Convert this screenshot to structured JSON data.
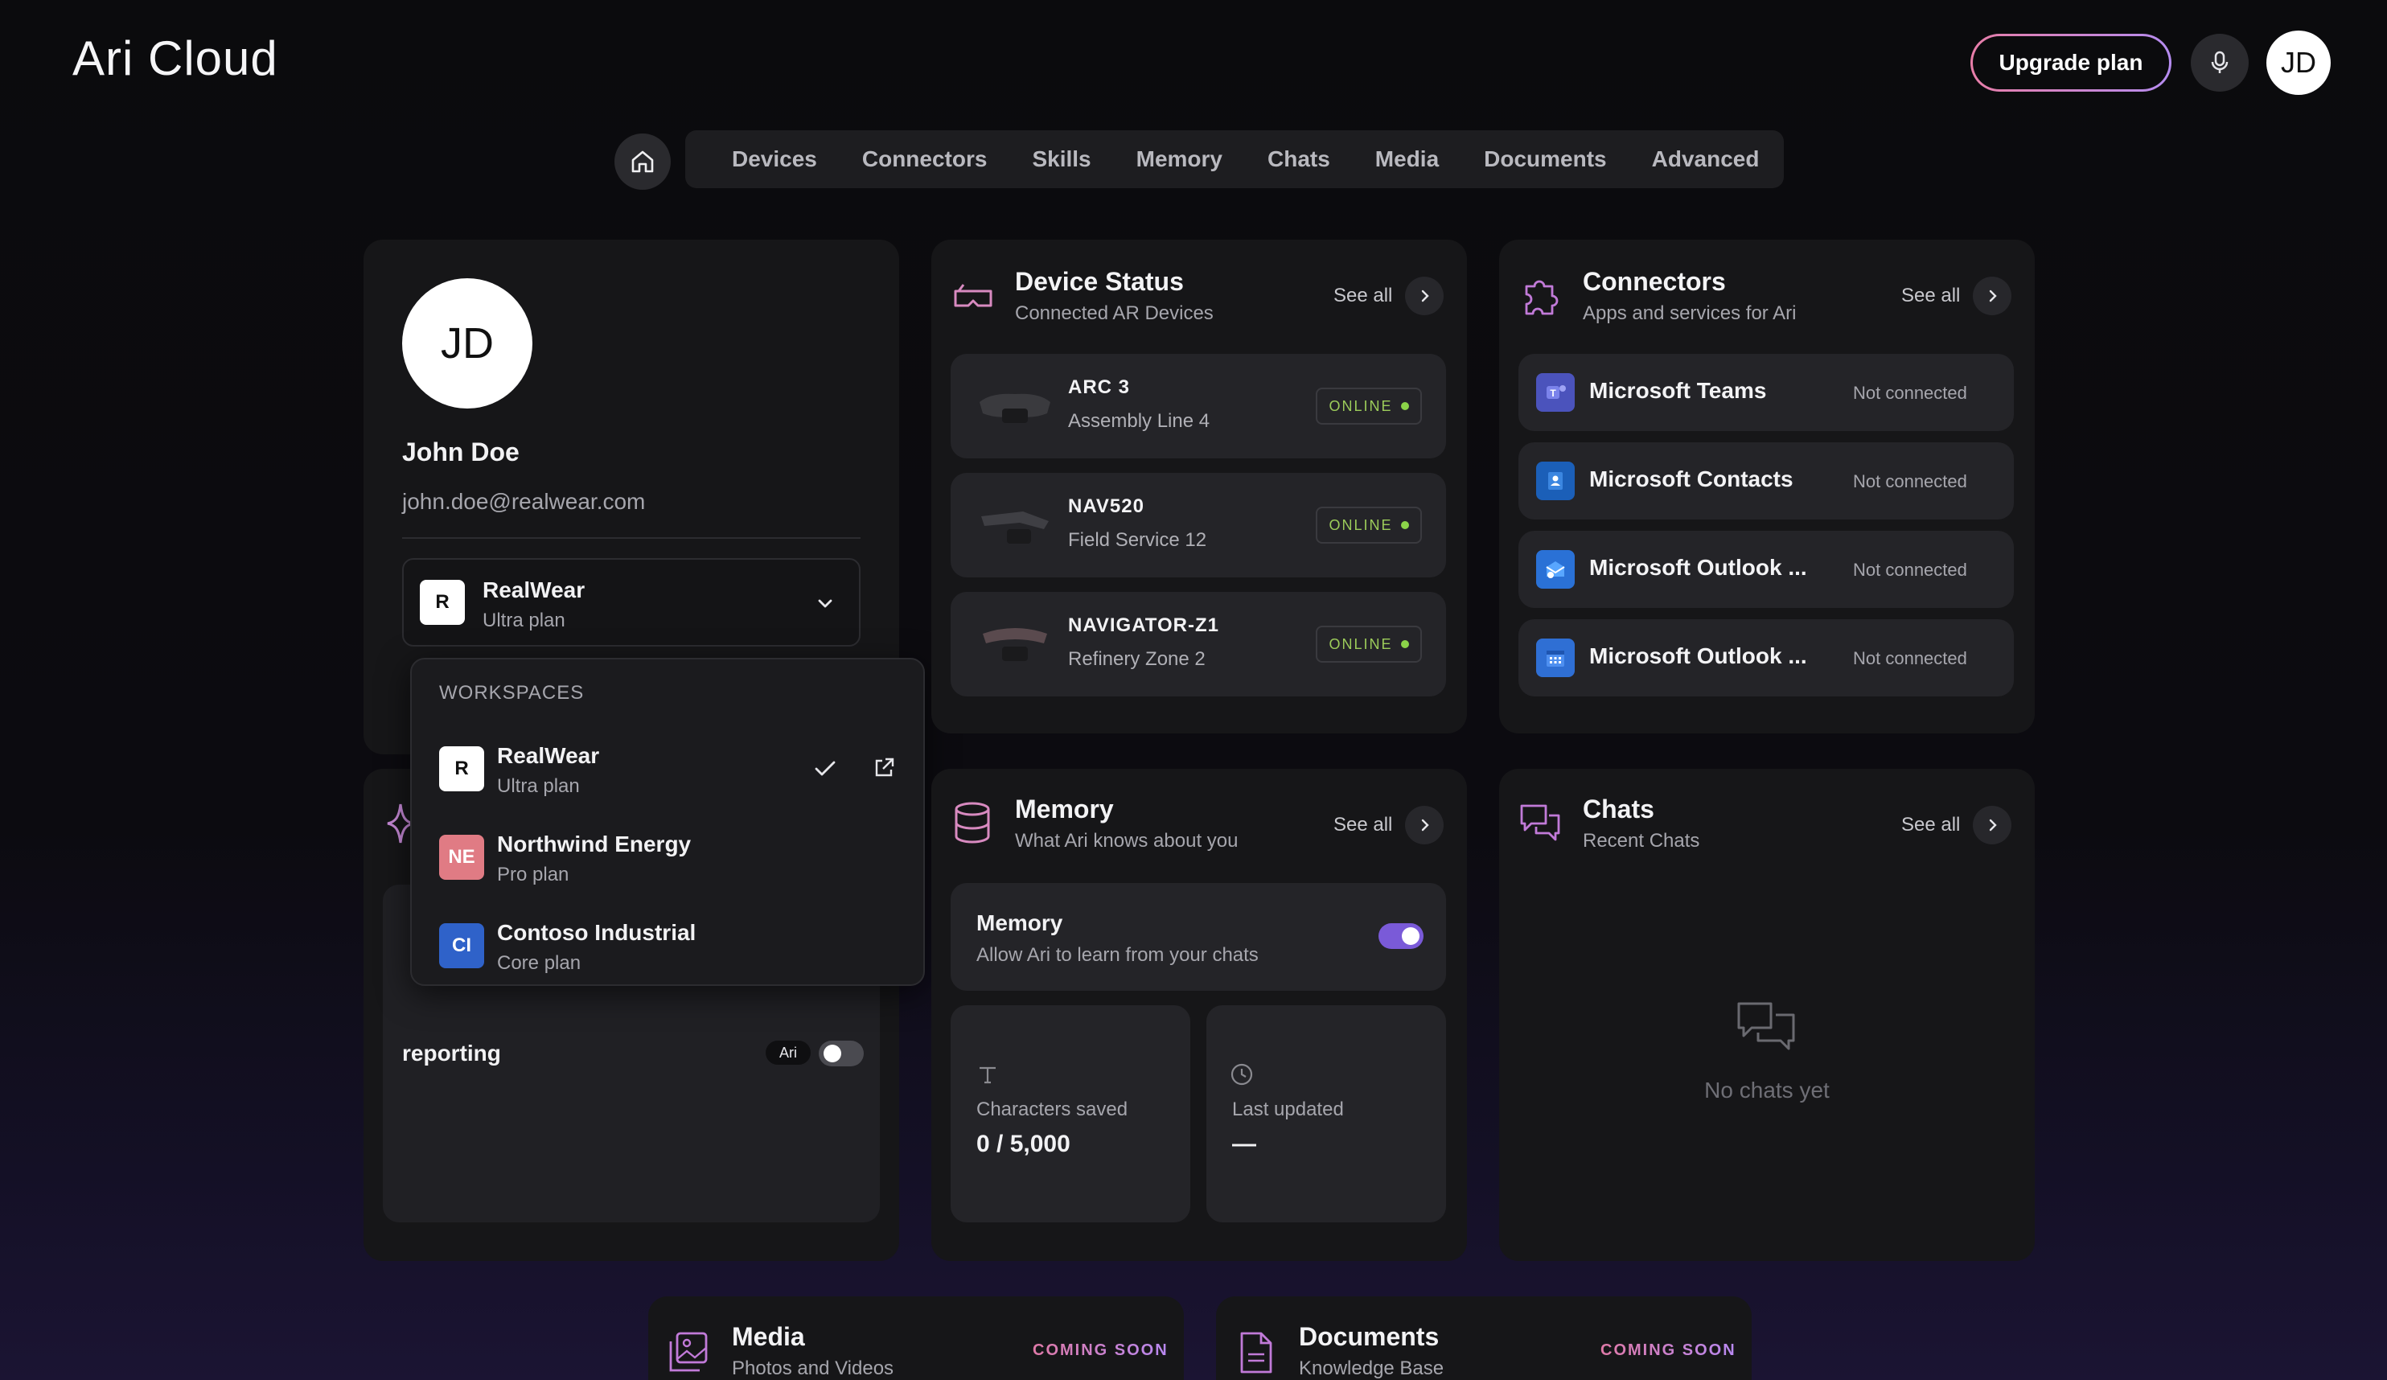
{
  "app": {
    "logo_text": "Ari Cloud"
  },
  "header": {
    "upgrade_label": "Upgrade plan",
    "avatar_initials": "JD",
    "mic_icon": "microphone-icon"
  },
  "nav": {
    "home_icon": "home-icon",
    "items": [
      "Devices",
      "Connectors",
      "Skills",
      "Memory",
      "Chats",
      "Media",
      "Documents",
      "Advanced"
    ]
  },
  "profile": {
    "initials": "JD",
    "name": "John Doe",
    "email": "john.doe@realwear.com",
    "workspace": {
      "badge": "R",
      "name": "RealWear",
      "plan": "Ultra plan"
    }
  },
  "workspaces_dropdown": {
    "heading": "WORKSPACES",
    "items": [
      {
        "badge": "R",
        "name": "RealWear",
        "plan": "Ultra plan",
        "selected": true,
        "badge_color": "#ffffff"
      },
      {
        "badge": "NE",
        "name": "Northwind Energy",
        "plan": "Pro plan",
        "selected": false,
        "badge_color": "#e07b84"
      },
      {
        "badge": "CI",
        "name": "Contoso Industrial",
        "plan": "Core plan",
        "selected": false,
        "badge_color": "#2f62c9"
      }
    ]
  },
  "skills_partial": {
    "item_label": "reporting",
    "badge": "Ari"
  },
  "device_status": {
    "title": "Device Status",
    "subtitle": "Connected AR Devices",
    "see_all": "See all",
    "devices": [
      {
        "name": "ARC 3",
        "location": "Assembly Line 4",
        "status": "ONLINE"
      },
      {
        "name": "NAV520",
        "location": "Field Service 12",
        "status": "ONLINE"
      },
      {
        "name": "NAVIGATOR-Z1",
        "location": "Refinery Zone 2",
        "status": "ONLINE"
      }
    ]
  },
  "connectors": {
    "title": "Connectors",
    "subtitle": "Apps and services for Ari",
    "see_all": "See all",
    "items": [
      {
        "name": "Microsoft Teams",
        "status": "Not connected",
        "icon": "teams-icon",
        "color": "#4b53bc"
      },
      {
        "name": "Microsoft Contacts",
        "status": "Not connected",
        "icon": "contacts-icon",
        "color": "#1b5fb8"
      },
      {
        "name": "Microsoft Outlook ...",
        "status": "Not connected",
        "icon": "outlook-mail-icon",
        "color": "#2a71d6"
      },
      {
        "name": "Microsoft Outlook ...",
        "status": "Not connected",
        "icon": "outlook-calendar-icon",
        "color": "#2f6fd4"
      }
    ]
  },
  "memory": {
    "title": "Memory",
    "subtitle": "What Ari knows about you",
    "see_all": "See all",
    "toggle_title": "Memory",
    "toggle_desc": "Allow Ari to learn from your chats",
    "toggle_on": true,
    "characters_label": "Characters saved",
    "characters_value": "0 / 5,000",
    "updated_label": "Last updated",
    "updated_value": "—"
  },
  "chats": {
    "title": "Chats",
    "subtitle": "Recent Chats",
    "see_all": "See all",
    "empty": "No chats yet"
  },
  "media": {
    "title": "Media",
    "subtitle": "Photos and Videos",
    "badge": "COMING SOON"
  },
  "documents": {
    "title": "Documents",
    "subtitle": "Knowledge Base",
    "badge": "COMING SOON"
  }
}
